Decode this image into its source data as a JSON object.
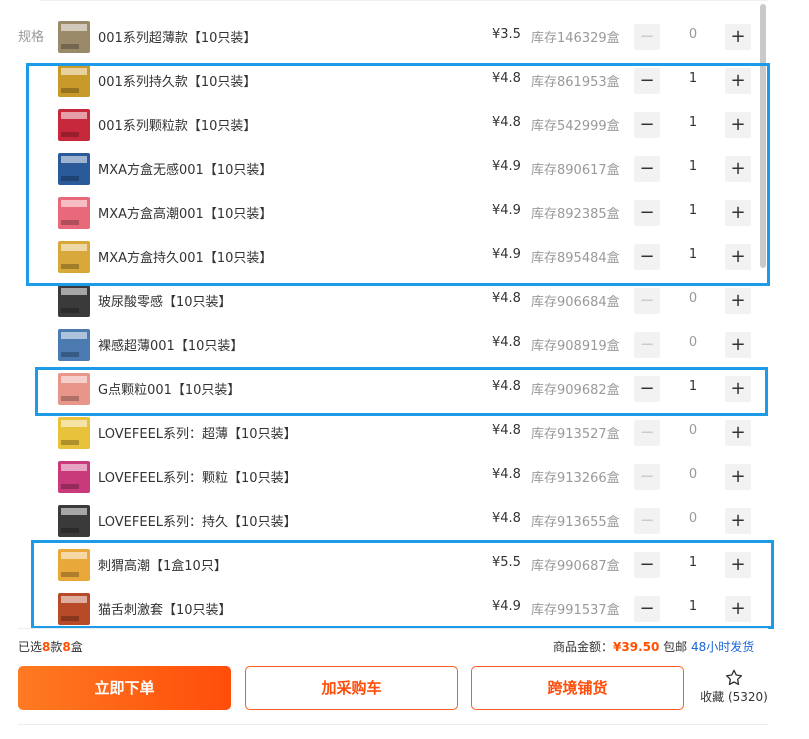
{
  "spec_label": "规格",
  "products": [
    {
      "name": "001系列超薄款【10只装】",
      "price": "¥3.5",
      "stock": "库存146329盒",
      "qty": "0",
      "thumb": "#9a8a6a"
    },
    {
      "name": "001系列持久款【10只装】",
      "price": "¥4.8",
      "stock": "库存861953盒",
      "qty": "1",
      "thumb": "#c89a2a"
    },
    {
      "name": "001系列颗粒款【10只装】",
      "price": "¥4.8",
      "stock": "库存542999盒",
      "qty": "1",
      "thumb": "#c8283c"
    },
    {
      "name": "MXA方盒无感001【10只装】",
      "price": "¥4.9",
      "stock": "库存890617盒",
      "qty": "1",
      "thumb": "#2a5a9a"
    },
    {
      "name": "MXA方盒高潮001【10只装】",
      "price": "¥4.9",
      "stock": "库存892385盒",
      "qty": "1",
      "thumb": "#e86a7a"
    },
    {
      "name": "MXA方盒持久001【10只装】",
      "price": "¥4.9",
      "stock": "库存895484盒",
      "qty": "1",
      "thumb": "#d8a83a"
    },
    {
      "name": "玻尿酸零感【10只装】",
      "price": "¥4.8",
      "stock": "库存906684盒",
      "qty": "0",
      "thumb": "#3a3a3a"
    },
    {
      "name": "裸感超薄001【10只装】",
      "price": "¥4.8",
      "stock": "库存908919盒",
      "qty": "0",
      "thumb": "#4a7ab0"
    },
    {
      "name": "G点颗粒001【10只装】",
      "price": "¥4.8",
      "stock": "库存909682盒",
      "qty": "1",
      "thumb": "#e8968a"
    },
    {
      "name": "LOVEFEEL系列：超薄【10只装】",
      "price": "¥4.8",
      "stock": "库存913527盒",
      "qty": "0",
      "thumb": "#e8c23a"
    },
    {
      "name": "LOVEFEEL系列：颗粒【10只装】",
      "price": "¥4.8",
      "stock": "库存913266盒",
      "qty": "0",
      "thumb": "#c83a7a"
    },
    {
      "name": "LOVEFEEL系列：持久【10只装】",
      "price": "¥4.8",
      "stock": "库存913655盒",
      "qty": "0",
      "thumb": "#3a3a3a"
    },
    {
      "name": "刺猬高潮【1盒10只】",
      "price": "¥5.5",
      "stock": "库存990687盒",
      "qty": "1",
      "thumb": "#e8a83a"
    },
    {
      "name": "猫舌刺激套【10只装】",
      "price": "¥4.9",
      "stock": "库存991537盒",
      "qty": "1",
      "thumb": "#b84a2a"
    }
  ],
  "controls": {
    "minus": "−",
    "plus": "+"
  },
  "summary": {
    "prefix": "已选",
    "kinds": "8",
    "kinds_unit": "款",
    "boxes": "8",
    "boxes_unit": "盒"
  },
  "amount": {
    "label": "商品金额：",
    "value": "¥39.50",
    "shipping": "包邮",
    "delivery": "48小时发货"
  },
  "buttons": {
    "order": "立即下单",
    "cart": "加采购车",
    "distribute": "跨境铺货"
  },
  "favorite": {
    "label": "收藏 (5320)"
  },
  "colors": {
    "accent": "#ff5000",
    "selection_box": "#1e9be6",
    "link": "#1a66d6"
  }
}
